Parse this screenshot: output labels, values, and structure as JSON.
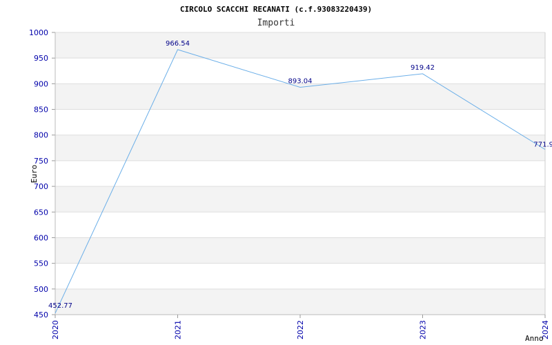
{
  "chart_data": {
    "type": "line",
    "title": "CIRCOLO SCACCHI RECANATI (c.f.93083220439)",
    "subtitle": "Importi",
    "xlabel": "Anno",
    "ylabel": "Euro",
    "categories": [
      "2020",
      "2021",
      "2022",
      "2023",
      "2024"
    ],
    "series": [
      {
        "values": [
          452.77,
          966.54,
          893.04,
          919.42,
          771.9
        ]
      }
    ],
    "data_labels": [
      "452.77",
      "966.54",
      "893.04",
      "919.42",
      "771.9"
    ],
    "ylim": [
      450,
      1000
    ],
    "yticks": [
      450,
      500,
      550,
      600,
      650,
      700,
      750,
      800,
      850,
      900,
      950,
      1000
    ],
    "grid": true,
    "colors": {
      "line": "#6aaee8",
      "band": "#f3f3f3",
      "grid": "#dddddd",
      "tick_text": "#0000aa",
      "label_text": "#000088"
    }
  }
}
